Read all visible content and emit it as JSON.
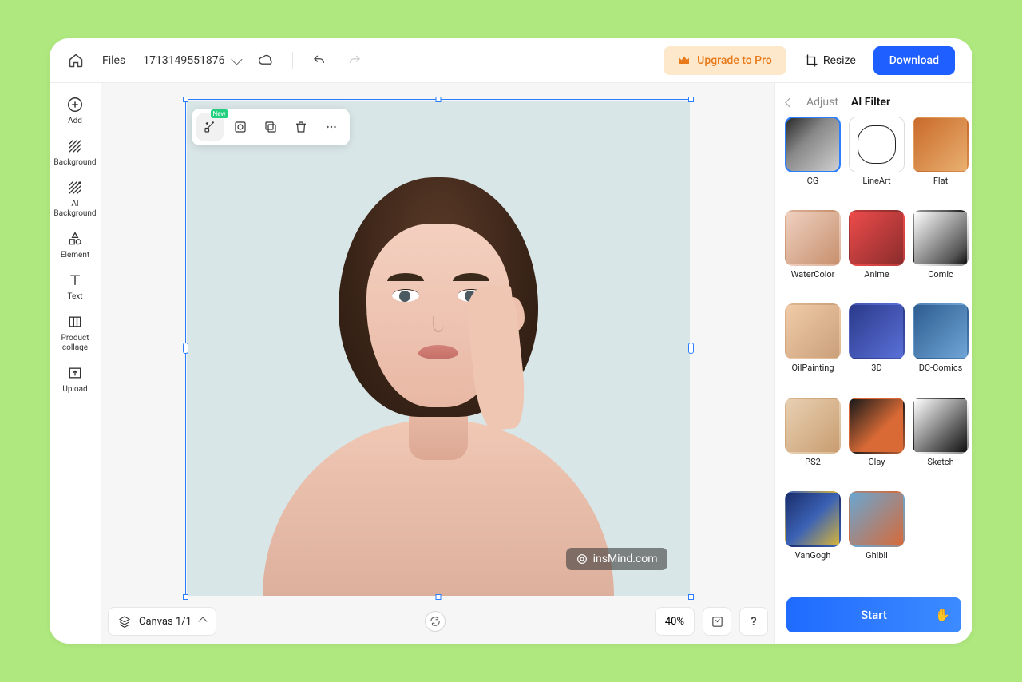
{
  "topbar": {
    "files_label": "Files",
    "filename": "1713149551876",
    "upgrade_label": "Upgrade to Pro",
    "resize_label": "Resize",
    "download_label": "Download"
  },
  "sidebar": {
    "items": [
      {
        "id": "add",
        "label": "Add"
      },
      {
        "id": "background",
        "label": "Background"
      },
      {
        "id": "ai-background",
        "label": "AI\nBackground"
      },
      {
        "id": "element",
        "label": "Element"
      },
      {
        "id": "text",
        "label": "Text"
      },
      {
        "id": "product-collage",
        "label": "Product\ncollage"
      },
      {
        "id": "upload",
        "label": "Upload"
      }
    ]
  },
  "floating_toolbar": {
    "badge": "New"
  },
  "watermark": "insMind.com",
  "bottombar": {
    "canvas_label": "Canvas 1/1",
    "zoom": "40%"
  },
  "right_panel": {
    "tabs": {
      "adjust": "Adjust",
      "ai_filter": "AI Filter"
    },
    "filters": [
      {
        "id": "cg",
        "label": "CG",
        "selected": true
      },
      {
        "id": "lineart",
        "label": "LineArt"
      },
      {
        "id": "flat",
        "label": "Flat"
      },
      {
        "id": "watercolor",
        "label": "WaterColor"
      },
      {
        "id": "anime",
        "label": "Anime"
      },
      {
        "id": "comic",
        "label": "Comic"
      },
      {
        "id": "oilpainting",
        "label": "OilPainting"
      },
      {
        "id": "3d",
        "label": "3D"
      },
      {
        "id": "dccomics",
        "label": "DC-Comics"
      },
      {
        "id": "ps2",
        "label": "PS2"
      },
      {
        "id": "clay",
        "label": "Clay"
      },
      {
        "id": "sketch",
        "label": "Sketch"
      },
      {
        "id": "vangogh",
        "label": "VanGogh"
      },
      {
        "id": "ghibli",
        "label": "Ghibli"
      }
    ],
    "start_label": "Start"
  }
}
